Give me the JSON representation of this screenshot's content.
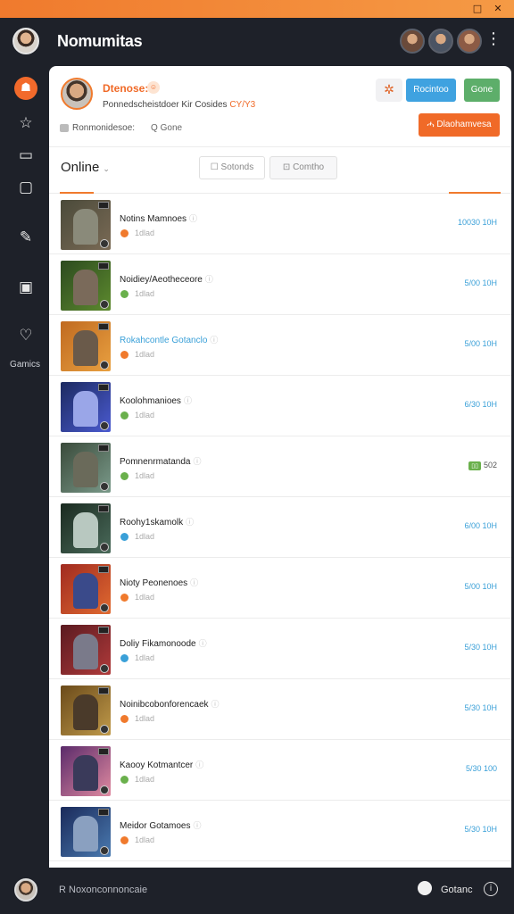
{
  "window": {
    "minimize_glyph": "□",
    "close_glyph": "✕"
  },
  "header": {
    "title": "Nomumitas",
    "more_glyph": "⋮",
    "friend_avatars": [
      "#6a4a3a",
      "#4b5463",
      "#8c5b45"
    ]
  },
  "sidebar": {
    "icons": [
      "home-icon",
      "star-icon",
      "chat-icon",
      "square-icon",
      "pencil-icon",
      "image-icon",
      "heart-icon"
    ],
    "glyphs": [
      "☗",
      "☆",
      "▭",
      "▢",
      "✎",
      "▣",
      "♡"
    ],
    "label": "Gamics"
  },
  "profile": {
    "name": "Dtenose:",
    "badge": "☺",
    "status_text": "Ponnedscheistdoer Kir Cosides",
    "status_accent": "CY/Y3",
    "tool_glyph": "✲",
    "btn_blue": "Rocintoo",
    "btn_green": "Gone",
    "meta_text": "Ronmonidesoe:",
    "meta_game": "Q Gone",
    "btn_orange": "ሓ Dlaohamvesa"
  },
  "filter": {
    "online_label": "Online",
    "caret": "⌄",
    "btn1": "☐ Sotonds",
    "btn2": "⊡ Comtho"
  },
  "rows": [
    {
      "name": "Notins Mamnoes",
      "status": "1dlad",
      "dot": "#f07a2d",
      "time": "10030 10H",
      "time_color": "#3aa0d8",
      "pill": "",
      "bg": "linear-gradient(135deg,#4a4a3a,#7a6a55)",
      "fig": "#8a8a7a"
    },
    {
      "name": "Noidiey/Aeotheceore",
      "status": "1dlad",
      "dot": "#6ab04c",
      "time": "5/00 10H",
      "time_color": "#3aa0d8",
      "pill": "",
      "bg": "linear-gradient(135deg,#2c4a1f,#5d8a2e)",
      "fig": "#7a6a5a"
    },
    {
      "name": "Rokahcontle Gotanclo",
      "status": "1dlad",
      "dot": "#f07a2d",
      "time": "5/00 10H",
      "time_color": "#3aa0d8",
      "pill": "",
      "bg": "linear-gradient(135deg,#c06a20,#e8a040)",
      "fig": "#6a5a4a",
      "name_color": "#3aa0d8"
    },
    {
      "name": "Koolohmanioes",
      "status": "1dlad",
      "dot": "#6ab04c",
      "time": "6/30 10H",
      "time_color": "#3aa0d8",
      "pill": "",
      "bg": "linear-gradient(135deg,#1c2a60,#4a5ad0)",
      "fig": "#9aa6e8"
    },
    {
      "name": "Pomnenrmatanda",
      "status": "1dlad",
      "dot": "#6ab04c",
      "time": "502",
      "time_color": "#555",
      "pill": "▯▯",
      "bg": "linear-gradient(135deg,#3a4a3a,#7a9a8a)",
      "fig": "#6a6a5a"
    },
    {
      "name": "Roohy1skamolk",
      "status": "1dlad",
      "dot": "#3aa0d8",
      "time": "6/00 10H",
      "time_color": "#3aa0d8",
      "pill": "",
      "bg": "linear-gradient(135deg,#1a2a20,#4a6a5a)",
      "fig": "#b8c8c0"
    },
    {
      "name": "Nioty Peonenoes",
      "status": "1dlad",
      "dot": "#f07a2d",
      "time": "5/00 10H",
      "time_color": "#3aa0d8",
      "pill": "",
      "bg": "linear-gradient(135deg,#a02a20,#e06a30)",
      "fig": "#3a4a8a"
    },
    {
      "name": "Doliy Fikamonoode",
      "status": "1dlad",
      "dot": "#3aa0d8",
      "time": "5/30 10H",
      "time_color": "#3aa0d8",
      "pill": "",
      "bg": "linear-gradient(135deg,#5a1a20,#b03a3a)",
      "fig": "#7a7a8a"
    },
    {
      "name": "Noinibcobonforencaek",
      "status": "1dlad",
      "dot": "#f07a2d",
      "time": "5/30 10H",
      "time_color": "#3aa0d8",
      "pill": "",
      "bg": "linear-gradient(135deg,#6a4a1a,#c09a4a)",
      "fig": "#4a3a2a"
    },
    {
      "name": "Kaooy Kotmantcer",
      "status": "1dlad",
      "dot": "#6ab04c",
      "time": "5/30 100",
      "time_color": "#3aa0d8",
      "pill": "",
      "bg": "linear-gradient(135deg,#5a2a6a,#e08aa0)",
      "fig": "#3a3a5a"
    },
    {
      "name": "Meidor Gotamoes",
      "status": "1dlad",
      "dot": "#f07a2d",
      "time": "5/30 10H",
      "time_color": "#3aa0d8",
      "pill": "",
      "bg": "linear-gradient(135deg,#1a2a5a,#4a7ab0)",
      "fig": "#8aa0c0"
    }
  ],
  "footer": {
    "text": "R Noxonconnoncaie",
    "label": "Gotanc",
    "info_glyph": "i"
  }
}
